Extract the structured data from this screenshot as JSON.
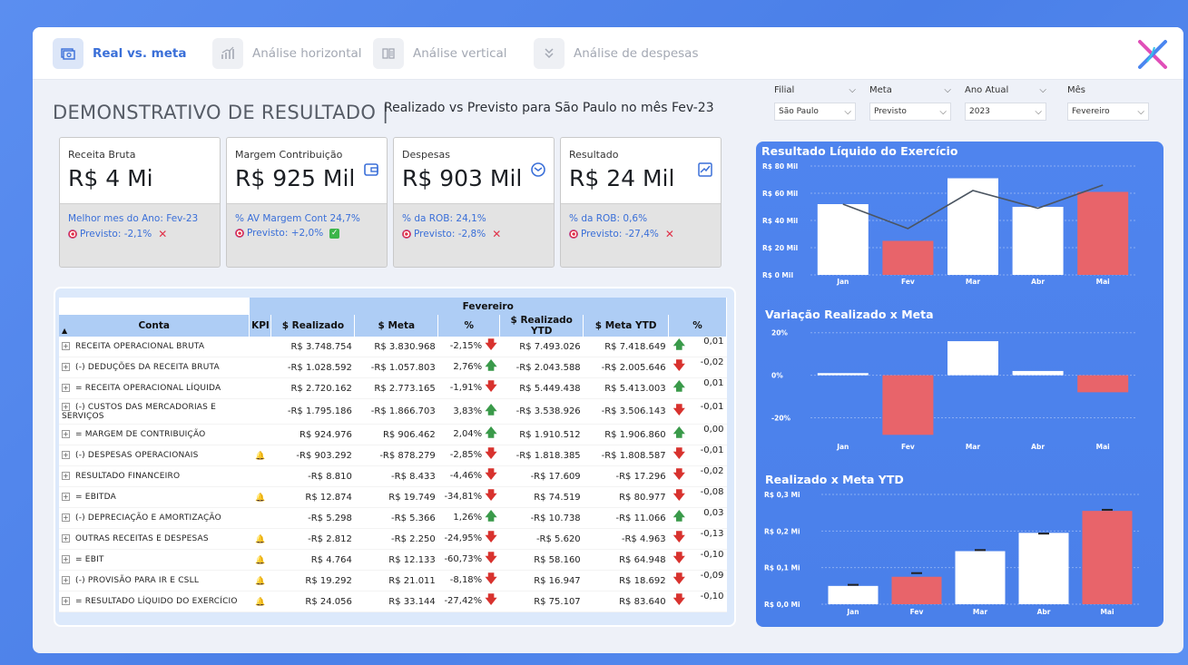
{
  "nav": {
    "tabs": [
      {
        "label": "Real vs. meta",
        "icon": "money-icon",
        "active": true
      },
      {
        "label": "Análise horizontal",
        "icon": "bar-chart-icon",
        "active": false
      },
      {
        "label": "Análise vertical",
        "icon": "book-icon",
        "active": false
      },
      {
        "label": "Análise de despesas",
        "icon": "chevron-double-icon",
        "active": false
      }
    ]
  },
  "header": {
    "title": "DEMONSTRATIVO DE RESULTADO |",
    "subtitle": "Realizado vs Previsto para São Paulo no mês  Fev-23"
  },
  "filters": [
    {
      "label": "Filial",
      "value": "São Paulo"
    },
    {
      "label": "Meta",
      "value": "Previsto"
    },
    {
      "label": "Ano Atual",
      "value": "2023"
    },
    {
      "label": "Mês",
      "value": "Fevereiro"
    }
  ],
  "kpis": [
    {
      "label": "Receita Bruta",
      "value": "R$ 4 Mi",
      "line1": "Melhor mes do Ano: Fev-23",
      "line2": "Previsto: -2,1%",
      "status": "x"
    },
    {
      "label": "Margem Contribuição",
      "value": "R$ 925 Mil",
      "line1": "% AV Margem Cont 24,7%",
      "line2": "Previsto: +2,0%",
      "status": "check"
    },
    {
      "label": "Despesas",
      "value": "R$ 903 Mil",
      "line1": "% da ROB: 24,1%",
      "line2": "Previsto: -2,8%",
      "status": "x"
    },
    {
      "label": "Resultado",
      "value": "R$ 24 Mil",
      "line1": "% da ROB: 0,6%",
      "line2": "Previsto: -27,4%",
      "status": "x"
    }
  ],
  "table": {
    "group_header": "Fevereiro",
    "columns": [
      "Conta",
      "KPI",
      "$ Realizado",
      "$ Meta",
      "%",
      "$ Realizado YTD",
      "$ Meta YTD",
      "%"
    ],
    "rows": [
      {
        "conta": "RECEITA OPERACIONAL BRUTA",
        "kpi": "",
        "realizado": "R$ 3.748.754",
        "meta": "R$ 3.830.968",
        "pct": "-2,15%",
        "dir": "down",
        "real_ytd": "R$ 7.493.026",
        "meta_ytd": "R$ 7.418.649",
        "dir_ytd": "up",
        "pct_ytd": "0,01"
      },
      {
        "conta": "(-) DEDUÇÕES DA RECEITA BRUTA",
        "kpi": "",
        "realizado": "-R$ 1.028.592",
        "meta": "-R$ 1.057.803",
        "pct": "2,76%",
        "dir": "up",
        "real_ytd": "-R$ 2.043.588",
        "meta_ytd": "-R$ 2.005.646",
        "dir_ytd": "down",
        "pct_ytd": "-0,02"
      },
      {
        "conta": "= RECEITA OPERACIONAL LÍQUIDA",
        "kpi": "",
        "realizado": "R$ 2.720.162",
        "meta": "R$ 2.773.165",
        "pct": "-1,91%",
        "dir": "down",
        "real_ytd": "R$ 5.449.438",
        "meta_ytd": "R$ 5.413.003",
        "dir_ytd": "up",
        "pct_ytd": "0,01"
      },
      {
        "conta": "(-) CUSTOS DAS MERCADORIAS E SERVIÇOS",
        "kpi": "",
        "realizado": "-R$ 1.795.186",
        "meta": "-R$ 1.866.703",
        "pct": "3,83%",
        "dir": "up",
        "real_ytd": "-R$ 3.538.926",
        "meta_ytd": "-R$ 3.506.143",
        "dir_ytd": "down",
        "pct_ytd": "-0,01"
      },
      {
        "conta": "= MARGEM DE CONTRIBUIÇÃO",
        "kpi": "",
        "realizado": "R$ 924.976",
        "meta": "R$ 906.462",
        "pct": "2,04%",
        "dir": "up",
        "real_ytd": "R$ 1.910.512",
        "meta_ytd": "R$ 1.906.860",
        "dir_ytd": "up",
        "pct_ytd": "0,00"
      },
      {
        "conta": "(-) DESPESAS OPERACIONAIS",
        "kpi": "bell",
        "realizado": "-R$ 903.292",
        "meta": "-R$ 878.279",
        "pct": "-2,85%",
        "dir": "down",
        "real_ytd": "-R$ 1.818.385",
        "meta_ytd": "-R$ 1.808.587",
        "dir_ytd": "down",
        "pct_ytd": "-0,01"
      },
      {
        "conta": "RESULTADO FINANCEIRO",
        "kpi": "",
        "realizado": "-R$ 8.810",
        "meta": "-R$ 8.433",
        "pct": "-4,46%",
        "dir": "down",
        "real_ytd": "-R$ 17.609",
        "meta_ytd": "-R$ 17.296",
        "dir_ytd": "down",
        "pct_ytd": "-0,02"
      },
      {
        "conta": "= EBITDA",
        "kpi": "bell",
        "realizado": "R$ 12.874",
        "meta": "R$ 19.749",
        "pct": "-34,81%",
        "dir": "down",
        "real_ytd": "R$ 74.519",
        "meta_ytd": "R$ 80.977",
        "dir_ytd": "down",
        "pct_ytd": "-0,08"
      },
      {
        "conta": "(-) DEPRECIAÇÃO E AMORTIZAÇÃO",
        "kpi": "",
        "realizado": "-R$ 5.298",
        "meta": "-R$ 5.366",
        "pct": "1,26%",
        "dir": "up",
        "real_ytd": "-R$ 10.738",
        "meta_ytd": "-R$ 11.066",
        "dir_ytd": "up",
        "pct_ytd": "0,03"
      },
      {
        "conta": "OUTRAS RECEITAS E DESPESAS",
        "kpi": "bell",
        "realizado": "-R$ 2.812",
        "meta": "-R$ 2.250",
        "pct": "-24,95%",
        "dir": "down",
        "real_ytd": "-R$ 5.620",
        "meta_ytd": "-R$ 4.963",
        "dir_ytd": "down",
        "pct_ytd": "-0,13"
      },
      {
        "conta": "= EBIT",
        "kpi": "bell",
        "realizado": "R$ 4.764",
        "meta": "R$ 12.133",
        "pct": "-60,73%",
        "dir": "down",
        "real_ytd": "R$ 58.160",
        "meta_ytd": "R$ 64.948",
        "dir_ytd": "down",
        "pct_ytd": "-0,10"
      },
      {
        "conta": "(-) PROVISÃO PARA IR E CSLL",
        "kpi": "bell",
        "realizado": "R$ 19.292",
        "meta": "R$ 21.011",
        "pct": "-8,18%",
        "dir": "down",
        "real_ytd": "R$ 16.947",
        "meta_ytd": "R$ 18.692",
        "dir_ytd": "down",
        "pct_ytd": "-0,09"
      },
      {
        "conta": "= RESULTADO LÍQUIDO DO EXERCÍCIO",
        "kpi": "bell",
        "realizado": "R$ 24.056",
        "meta": "R$ 33.144",
        "pct": "-27,42%",
        "dir": "down",
        "real_ytd": "R$ 75.107",
        "meta_ytd": "R$ 83.640",
        "dir_ytd": "down",
        "pct_ytd": "-0,10"
      }
    ]
  },
  "colors": {
    "accent": "#3a6fd8",
    "highlight": "#e8646a",
    "white": "#ffffff",
    "panel": "#4f84ee"
  },
  "chart_data": [
    {
      "type": "bar",
      "title": "Resultado Líquido do Exercício",
      "categories": [
        "Jan",
        "Fev",
        "Mar",
        "Abr",
        "Mai"
      ],
      "series": [
        {
          "values": [
            52,
            25,
            71,
            50,
            61
          ]
        }
      ],
      "line": [
        52,
        34,
        62,
        49,
        66
      ],
      "highlight": [
        1,
        4
      ],
      "yticks": [
        "R$ 0 Mil",
        "R$ 20 Mil",
        "R$ 40 Mil",
        "R$ 60 Mil",
        "R$ 80 Mil"
      ],
      "ylim": [
        0,
        80
      ]
    },
    {
      "type": "bar",
      "title": "Variação Realizado x Meta",
      "categories": [
        "Jan",
        "Fev",
        "Mar",
        "Abr",
        "Mai"
      ],
      "series": [
        {
          "values": [
            1,
            -28,
            16,
            2,
            -8
          ]
        }
      ],
      "highlight": [
        1,
        4
      ],
      "yticks": [
        "20%",
        "0%",
        "-20%"
      ],
      "ylim": [
        -30,
        22
      ]
    },
    {
      "type": "bar",
      "title": "Realizado x Meta YTD",
      "categories": [
        "Jan",
        "Fev",
        "Mar",
        "Abr",
        "Mai"
      ],
      "series": [
        {
          "values": [
            0.05,
            0.075,
            0.145,
            0.195,
            0.255
          ]
        }
      ],
      "markers": [
        0.053,
        0.085,
        0.148,
        0.193,
        0.258
      ],
      "highlight": [
        1,
        4
      ],
      "yticks": [
        "R$ 0,0 Mi",
        "R$ 0,1 Mi",
        "R$ 0,2 Mi",
        "R$ 0,3 Mi"
      ],
      "ylim": [
        0,
        0.3
      ]
    }
  ]
}
